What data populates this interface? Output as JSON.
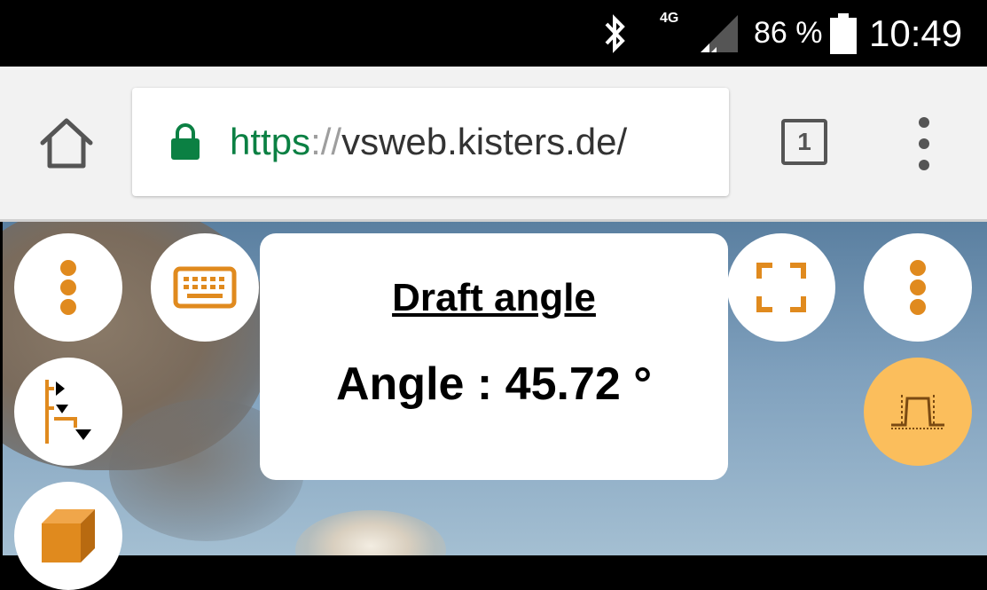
{
  "status_bar": {
    "network": "4G",
    "battery_percent": "86 %",
    "time": "10:49",
    "icons": [
      "bluetooth-icon",
      "signal-icon",
      "battery-icon"
    ]
  },
  "browser": {
    "url_scheme": "https",
    "url_separator": "://",
    "url_rest": "vsweb.kisters.de/",
    "tab_count": "1",
    "secure_color": "#0b8043"
  },
  "viewer": {
    "accent_color": "#e08a1e",
    "active_fab_color": "#fbbe5c",
    "dialog": {
      "title": "Draft angle",
      "value": "Angle : 45.72 °"
    }
  }
}
